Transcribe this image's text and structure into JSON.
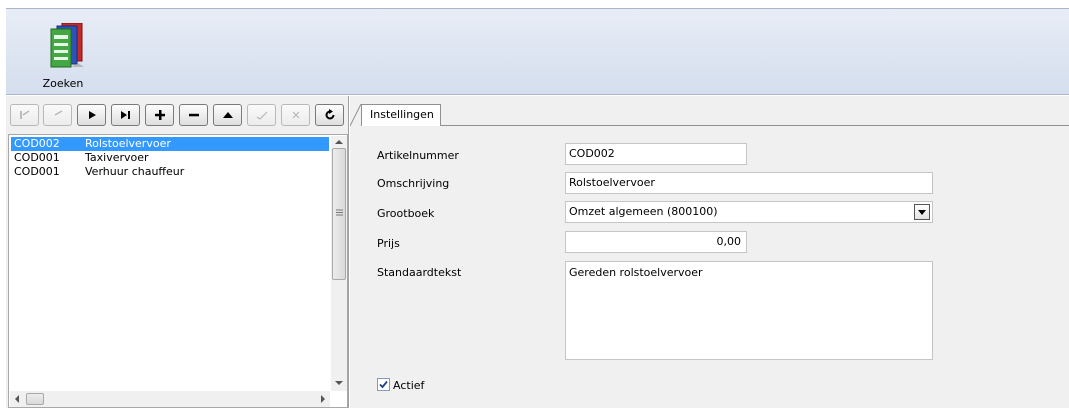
{
  "ribbon": {
    "search_button_label": "Zoeken",
    "search_icon": "books-search-icon"
  },
  "toolbar": {
    "buttons": [
      {
        "name": "first-record",
        "icon": "first-icon",
        "enabled": false
      },
      {
        "name": "previous-record",
        "icon": "previous-icon",
        "enabled": false
      },
      {
        "name": "next-record",
        "icon": "play-icon",
        "enabled": true
      },
      {
        "name": "last-record",
        "icon": "last-icon",
        "enabled": true
      },
      {
        "name": "add-record",
        "icon": "plus-icon",
        "enabled": true
      },
      {
        "name": "delete-record",
        "icon": "minus-icon",
        "enabled": true
      },
      {
        "name": "edit-record",
        "icon": "up-triangle-icon",
        "enabled": true
      },
      {
        "name": "post-record",
        "icon": "check-icon",
        "enabled": false
      },
      {
        "name": "cancel-record",
        "icon": "x-icon",
        "enabled": false
      },
      {
        "name": "refresh",
        "icon": "refresh-icon",
        "enabled": true
      }
    ]
  },
  "list": {
    "rows": [
      {
        "code": "COD002",
        "description": "Rolstoelvervoer",
        "selected": true
      },
      {
        "code": "COD001",
        "description": "Taxivervoer",
        "selected": false
      },
      {
        "code": "COD001",
        "description": "Verhuur chauffeur",
        "selected": false
      }
    ]
  },
  "form": {
    "tab_label": "Instellingen",
    "artikelnummer_label": "Artikelnummer",
    "artikelnummer_value": "COD002",
    "omschrijving_label": "Omschrijving",
    "omschrijving_value": "Rolstoelvervoer",
    "grootboek_label": "Grootboek",
    "grootboek_value": "Omzet algemeen (800100)",
    "prijs_label": "Prijs",
    "prijs_value": "0,00",
    "standaardtekst_label": "Standaardtekst",
    "standaardtekst_value": "Gereden rolstoelvervoer",
    "actief_label": "Actief",
    "actief_checked": true
  },
  "colors": {
    "selection": "#3399ff",
    "ribbon": "#d4deee"
  }
}
